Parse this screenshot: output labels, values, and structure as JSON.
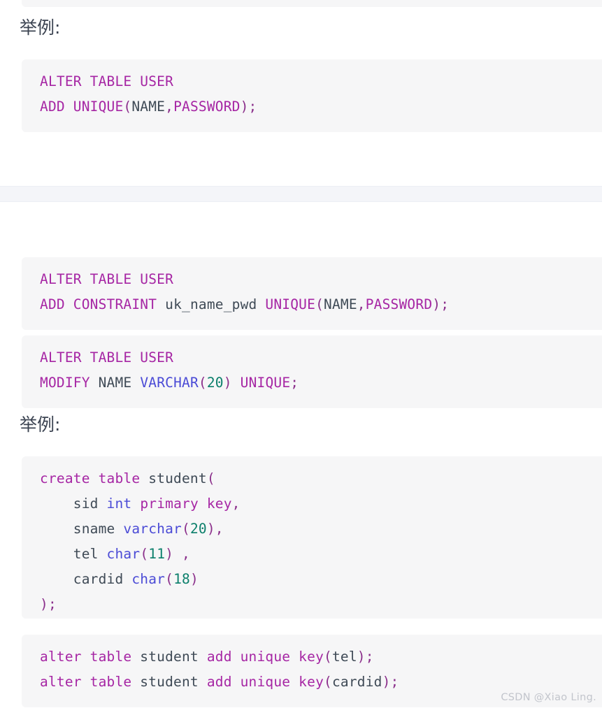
{
  "document": {
    "language": "sql",
    "watermark": "CSDN @Xiao Ling.",
    "colors": {
      "page_background": "#ffffff",
      "code_background": "#f6f6f7",
      "keyword": "#a626a4",
      "datatype": "#4b4bd6",
      "identifier": "#3f4a56",
      "number": "#0b7f6b",
      "punctuation": "#8b2f8b",
      "heading_text": "#3b4351",
      "divider_band": "#f4f5f9",
      "watermark_text": "#c2c5cc"
    }
  },
  "headings": {
    "example_1": "举例:",
    "example_2": "举例:"
  },
  "code_blocks": {
    "block_0_clipped": {
      "lines": [
        {
          "tokens": []
        }
      ],
      "plain": ""
    },
    "block_1": {
      "plain": "ALTER TABLE USER\nADD UNIQUE(NAME,PASSWORD);",
      "lines": [
        {
          "tokens": [
            {
              "t": "ALTER TABLE USER",
              "c": "kw"
            }
          ]
        },
        {
          "tokens": [
            {
              "t": "ADD UNIQUE",
              "c": "kw"
            },
            {
              "t": "(",
              "c": "pun"
            },
            {
              "t": "NAME",
              "c": "id"
            },
            {
              "t": ",",
              "c": "pun"
            },
            {
              "t": "PASSWORD",
              "c": "kw"
            },
            {
              "t": ");",
              "c": "pun"
            }
          ]
        }
      ]
    },
    "block_2": {
      "plain": "ALTER TABLE USER\nADD CONSTRAINT uk_name_pwd UNIQUE(NAME,PASSWORD);",
      "lines": [
        {
          "tokens": [
            {
              "t": "ALTER TABLE USER",
              "c": "kw"
            }
          ]
        },
        {
          "tokens": [
            {
              "t": "ADD CONSTRAINT",
              "c": "kw"
            },
            {
              "t": " ",
              "c": "id"
            },
            {
              "t": "uk_name_pwd",
              "c": "id"
            },
            {
              "t": " ",
              "c": "id"
            },
            {
              "t": "UNIQUE",
              "c": "kw"
            },
            {
              "t": "(",
              "c": "pun"
            },
            {
              "t": "NAME",
              "c": "id"
            },
            {
              "t": ",",
              "c": "pun"
            },
            {
              "t": "PASSWORD",
              "c": "kw"
            },
            {
              "t": ");",
              "c": "pun"
            }
          ]
        }
      ]
    },
    "block_3": {
      "plain": "ALTER TABLE USER\nMODIFY NAME VARCHAR(20) UNIQUE;",
      "lines": [
        {
          "tokens": [
            {
              "t": "ALTER TABLE USER",
              "c": "kw"
            }
          ]
        },
        {
          "tokens": [
            {
              "t": "MODIFY",
              "c": "kw"
            },
            {
              "t": " ",
              "c": "id"
            },
            {
              "t": "NAME",
              "c": "id"
            },
            {
              "t": " ",
              "c": "id"
            },
            {
              "t": "VARCHAR",
              "c": "typ"
            },
            {
              "t": "(",
              "c": "pun"
            },
            {
              "t": "20",
              "c": "num"
            },
            {
              "t": ")",
              "c": "pun"
            },
            {
              "t": " ",
              "c": "id"
            },
            {
              "t": "UNIQUE",
              "c": "kw"
            },
            {
              "t": ";",
              "c": "pun"
            }
          ]
        }
      ]
    },
    "block_4": {
      "plain": "create table student(\n    sid int primary key,\n    sname varchar(20),\n    tel char(11) ,\n    cardid char(18)\n);",
      "lines": [
        {
          "tokens": [
            {
              "t": "create table",
              "c": "kw"
            },
            {
              "t": " ",
              "c": "id"
            },
            {
              "t": "student",
              "c": "id"
            },
            {
              "t": "(",
              "c": "pun"
            }
          ]
        },
        {
          "tokens": [
            {
              "t": "    ",
              "c": "id"
            },
            {
              "t": "sid",
              "c": "id"
            },
            {
              "t": " ",
              "c": "id"
            },
            {
              "t": "int",
              "c": "typ"
            },
            {
              "t": " ",
              "c": "id"
            },
            {
              "t": "primary key",
              "c": "kw"
            },
            {
              "t": ",",
              "c": "pun"
            }
          ]
        },
        {
          "tokens": [
            {
              "t": "    ",
              "c": "id"
            },
            {
              "t": "sname",
              "c": "id"
            },
            {
              "t": " ",
              "c": "id"
            },
            {
              "t": "varchar",
              "c": "typ"
            },
            {
              "t": "(",
              "c": "pun"
            },
            {
              "t": "20",
              "c": "num"
            },
            {
              "t": "),",
              "c": "pun"
            }
          ]
        },
        {
          "tokens": [
            {
              "t": "    ",
              "c": "id"
            },
            {
              "t": "tel",
              "c": "id"
            },
            {
              "t": " ",
              "c": "id"
            },
            {
              "t": "char",
              "c": "typ"
            },
            {
              "t": "(",
              "c": "pun"
            },
            {
              "t": "11",
              "c": "num"
            },
            {
              "t": ") ,",
              "c": "pun"
            }
          ]
        },
        {
          "tokens": [
            {
              "t": "    ",
              "c": "id"
            },
            {
              "t": "cardid",
              "c": "id"
            },
            {
              "t": " ",
              "c": "id"
            },
            {
              "t": "char",
              "c": "typ"
            },
            {
              "t": "(",
              "c": "pun"
            },
            {
              "t": "18",
              "c": "num"
            },
            {
              "t": ")",
              "c": "pun"
            }
          ]
        },
        {
          "tokens": [
            {
              "t": ");",
              "c": "pun"
            }
          ]
        }
      ]
    },
    "block_5": {
      "plain": "alter table student add unique key(tel);\nalter table student add unique key(cardid);",
      "lines": [
        {
          "tokens": [
            {
              "t": "alter table",
              "c": "kw"
            },
            {
              "t": " ",
              "c": "id"
            },
            {
              "t": "student",
              "c": "id"
            },
            {
              "t": " ",
              "c": "id"
            },
            {
              "t": "add unique key",
              "c": "kw"
            },
            {
              "t": "(",
              "c": "pun"
            },
            {
              "t": "tel",
              "c": "id"
            },
            {
              "t": ");",
              "c": "pun"
            }
          ]
        },
        {
          "tokens": [
            {
              "t": "alter table",
              "c": "kw"
            },
            {
              "t": " ",
              "c": "id"
            },
            {
              "t": "student",
              "c": "id"
            },
            {
              "t": " ",
              "c": "id"
            },
            {
              "t": "add unique key",
              "c": "kw"
            },
            {
              "t": "(",
              "c": "pun"
            },
            {
              "t": "cardid",
              "c": "id"
            },
            {
              "t": ");",
              "c": "pun"
            }
          ]
        }
      ]
    }
  }
}
